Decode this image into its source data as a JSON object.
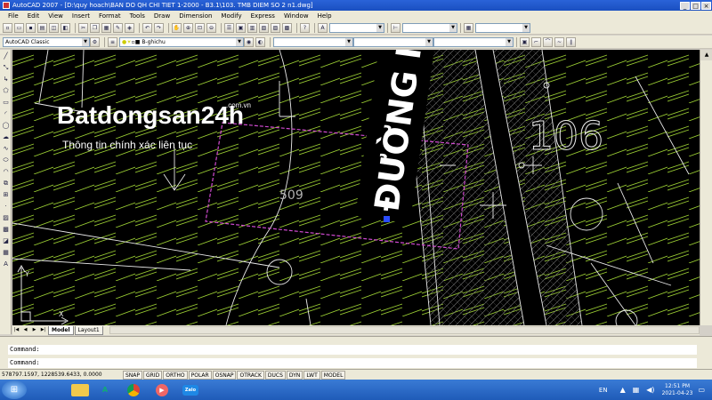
{
  "window": {
    "title": "AutoCAD 2007 - [D:\\quy hoach\\BAN DO QH CHI TIET 1-2000 - B3.1\\103. TMB DIEM SO 2 n1.dwg]",
    "controls": [
      "_",
      "□",
      "×"
    ]
  },
  "menu": [
    "File",
    "Edit",
    "View",
    "Insert",
    "Format",
    "Tools",
    "Draw",
    "Dimension",
    "Modify",
    "Express",
    "Window",
    "Help"
  ],
  "toolbar": {
    "workspace": "AutoCAD Classic",
    "layer": "B-ghichu",
    "textstyle_icon": "text-style-icon"
  },
  "drawing": {
    "lot_number": "509",
    "street_label": "ĐƯỜNG N",
    "block_number": "106",
    "colors": {
      "hatch": "#9acd32",
      "lines": "#e8e8e8",
      "selection": "#d24bd2",
      "grip": "#2a4cff",
      "background": "#000000"
    }
  },
  "watermark": {
    "brand": "Batdongsan24h",
    "domain": ".com.vn",
    "tagline": "Thông tin chính xác liên tục"
  },
  "tabs": [
    "Model",
    "Layout1"
  ],
  "command": {
    "line1": "Command:",
    "line2": "Command:"
  },
  "status": {
    "coords": "578797.1597, 1228539.6433, 0.0000",
    "buttons": [
      "SNAP",
      "GRID",
      "ORTHO",
      "POLAR",
      "OSNAP",
      "OTRACK",
      "DUCS",
      "DYN",
      "LWT",
      "MODEL"
    ]
  },
  "taskbar": {
    "language": "EN",
    "time": "12:51 PM",
    "date": "2021-04-23",
    "apps": [
      "explorer-icon",
      "autocad-icon",
      "chrome-icon",
      "media-icon",
      "zalo-icon"
    ],
    "zalo_label": "Zalo"
  }
}
